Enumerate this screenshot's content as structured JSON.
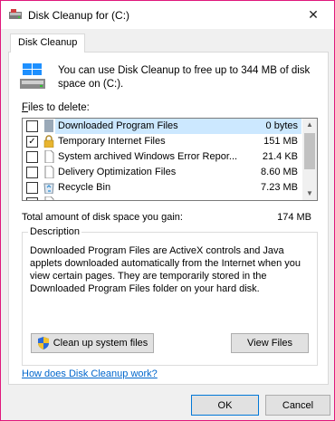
{
  "window": {
    "title": "Disk Cleanup for  (C:)",
    "close_glyph": "✕"
  },
  "tabs": [
    {
      "label": "Disk Cleanup"
    }
  ],
  "intro": {
    "text": "You can use Disk Cleanup to free up to 344 MB of disk space on  (C:)."
  },
  "files_label": {
    "prefix": "F",
    "rest": "iles to delete:"
  },
  "files": [
    {
      "label": "Downloaded Program Files",
      "size": "0 bytes",
      "checked": false,
      "selected": true,
      "icon": "blank-file-icon"
    },
    {
      "label": "Temporary Internet Files",
      "size": "151 MB",
      "checked": true,
      "selected": false,
      "icon": "lock-icon"
    },
    {
      "label": "System archived Windows Error Repor...",
      "size": "21.4 KB",
      "checked": false,
      "selected": false,
      "icon": "document-icon"
    },
    {
      "label": "Delivery Optimization Files",
      "size": "8.60 MB",
      "checked": false,
      "selected": false,
      "icon": "document-icon"
    },
    {
      "label": "Recycle Bin",
      "size": "7.23 MB",
      "checked": false,
      "selected": false,
      "icon": "recycle-bin-icon"
    },
    {
      "label": "",
      "size": "",
      "checked": false,
      "selected": false,
      "icon": "document-icon"
    }
  ],
  "total": {
    "label": "Total amount of disk space you gain:",
    "value": "174 MB"
  },
  "description": {
    "legend": "Description",
    "text": "Downloaded Program Files are ActiveX controls and Java applets downloaded automatically from the Internet when you view certain pages. They are temporarily stored in the Downloaded Program Files folder on your hard disk."
  },
  "buttons": {
    "cleanup_system": "Clean up system files",
    "view_files": "View Files",
    "ok": "OK",
    "cancel": "Cancel"
  },
  "help_link": "How does Disk Cleanup work?",
  "colors": {
    "accent_border": "#e0187c",
    "selection": "#cce8ff",
    "link": "#0066cc"
  }
}
